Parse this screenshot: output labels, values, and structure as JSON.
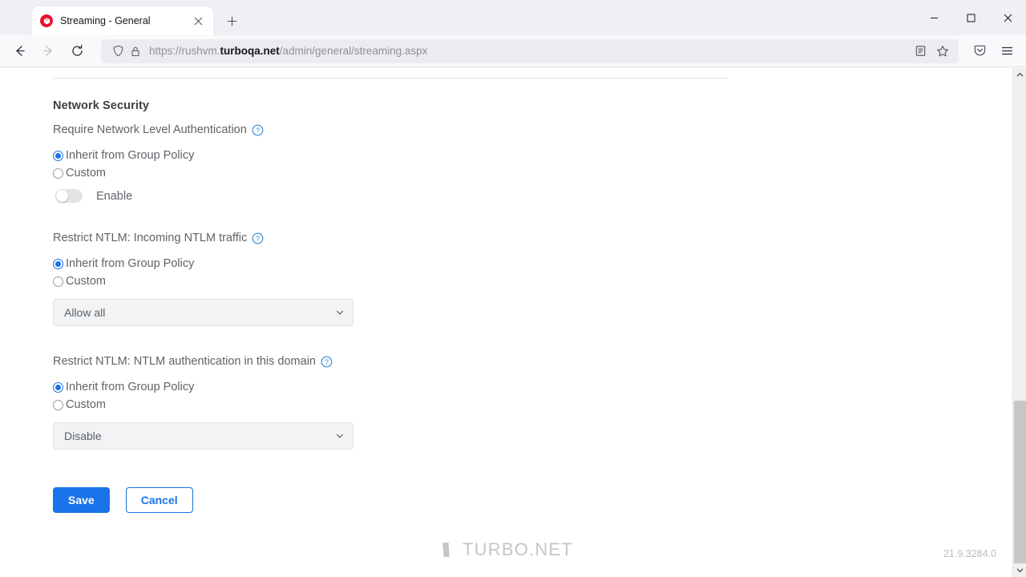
{
  "browser": {
    "tab": {
      "title": "Streaming - General",
      "favicon_name": "turbo-net-favicon",
      "close_label": "×",
      "favicon_color": "#e8112d"
    },
    "newtab_label": "+",
    "window_controls": {
      "minimize": "—",
      "maximize": "□",
      "close": "✕"
    },
    "nav": {
      "back": "←",
      "forward": "→",
      "reload": "⟳"
    },
    "url": {
      "prefix": "https://rushvm.",
      "domain": "turboqa.net",
      "path": "/admin/general/streaming.aspx",
      "full": "https://rushvm.turboqa.net/admin/general/streaming.aspx",
      "shield_icon": "tracking-protection-shield-icon",
      "lock_icon": "padlock-icon"
    },
    "url_actions": [
      {
        "name": "reader-view-icon"
      },
      {
        "name": "bookmark-star-icon"
      }
    ],
    "toolbar_right": [
      {
        "name": "pocket-save-icon"
      },
      {
        "name": "application-menu-icon"
      }
    ]
  },
  "page": {
    "section": {
      "title": "Network Security"
    },
    "fields": [
      {
        "label": "Require Network Level Authentication",
        "help_icon": "help-circle-icon",
        "options": [
          {
            "label": "Inherit from Group Policy",
            "selected": true
          },
          {
            "label": "Custom",
            "selected": false
          }
        ],
        "control": "toggle",
        "toggle": {
          "label": "Enable",
          "on": false
        }
      },
      {
        "label": "Restrict NTLM: Incoming NTLM traffic",
        "help_icon": "help-circle-icon",
        "options": [
          {
            "label": "Inherit from Group Policy",
            "selected": true
          },
          {
            "label": "Custom",
            "selected": false
          }
        ],
        "control": "select",
        "select": {
          "value": "Allow all"
        }
      },
      {
        "label": "Restrict NTLM: NTLM authentication in this domain",
        "help_icon": "help-circle-icon",
        "options": [
          {
            "label": "Inherit from Group Policy",
            "selected": true
          },
          {
            "label": "Custom",
            "selected": false
          }
        ],
        "control": "select",
        "select": {
          "value": "Disable"
        }
      }
    ],
    "buttons": {
      "save": "Save",
      "cancel": "Cancel"
    },
    "footer": {
      "logo_text": "TURBO.NET",
      "logo_mark": "turbo-slash-mark",
      "version": "21.9.3284.0"
    },
    "colors": {
      "accent": "#1a73e8",
      "label": "#5f6368",
      "heading": "#3c4043",
      "select_bg": "#f1f3f4"
    }
  },
  "scrollbar": {
    "up_arrow": "▲",
    "down_arrow": "▼"
  }
}
